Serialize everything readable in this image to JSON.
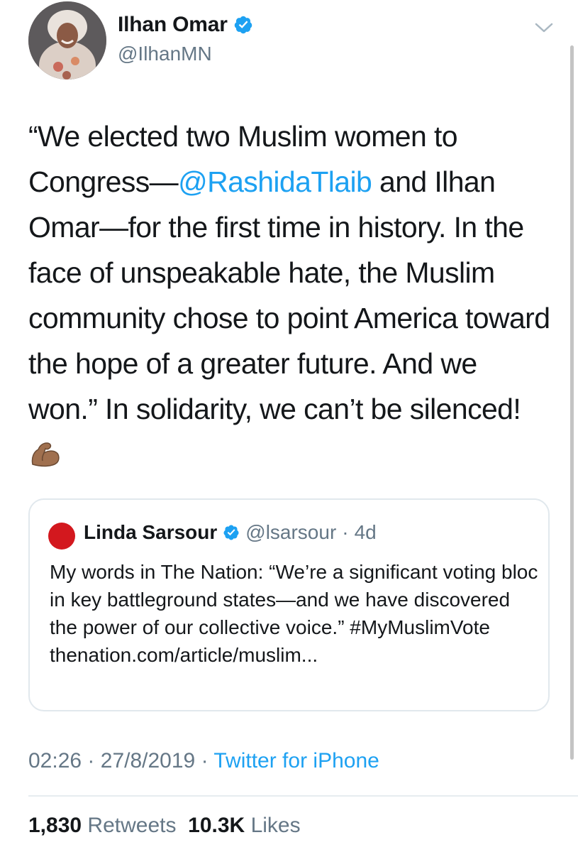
{
  "author": {
    "name": "Ilhan Omar",
    "handle": "@IlhanMN",
    "verified_icon": "verified-badge-icon",
    "avatar": "profile-photo"
  },
  "tweet": {
    "text_part1": "“We elected two Muslim women to Congress—",
    "mention": "@RashidaTlaib",
    "text_part2": " and Ilhan Omar—for the first time in history. In the face of unspeakable hate, the Muslim community chose to point America toward the hope of a greater future. And we won.” In solidarity, we can’t be silenced!",
    "emoji": "flexed-biceps-icon"
  },
  "quoted": {
    "name": "Linda Sarsour",
    "handle": "@lsarsour",
    "separator": "·",
    "age": "4d",
    "text": "My words in The Nation: “We’re a significant voting bloc in key battleground states—and we have discovered the power of our collective voice.” #MyMuslimVote thenation.com/article/muslim..."
  },
  "meta": {
    "time": "02:26",
    "date": "27/8/2019",
    "separator": "·",
    "source": "Twitter for iPhone"
  },
  "stats": {
    "retweets_count": "1,830",
    "retweets_label": "Retweets",
    "likes_count": "10.3K",
    "likes_label": "Likes"
  },
  "colors": {
    "link": "#1da1f2",
    "secondary_text": "#657786",
    "border": "#e1e8ed"
  }
}
